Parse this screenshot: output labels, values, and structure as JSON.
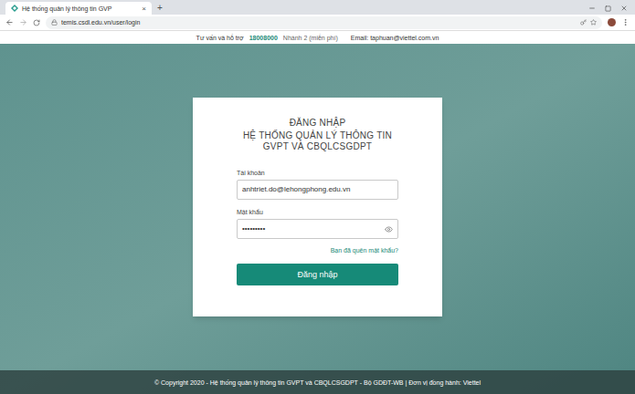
{
  "browser": {
    "tab": {
      "title": "Hệ thống quản lý thông tin GVP",
      "close": "×"
    },
    "new_tab": "+",
    "url": "temis.csdl.edu.vn/user/login"
  },
  "support_bar": {
    "label": "Tư vấn và hỗ trợ",
    "phone": "18008000",
    "branch": "Nhánh 2 (miễn phí)",
    "email": "Email: taphuan@viettel.com.vn"
  },
  "login": {
    "heading": "ĐĂNG NHẬP",
    "title_lines": [
      "HỆ THỐNG QUẢN LÝ THÔNG TIN",
      "GVPT VÀ CBQLCSGDPT"
    ],
    "fields": [
      {
        "label": "Tài khoản",
        "value": "anhtriet.do@lehongphong.edu.vn",
        "kind": "text"
      },
      {
        "label": "Mật khẩu",
        "value": "•••••••••",
        "kind": "password"
      }
    ],
    "forgot": "Bạn đã quên mật khẩu?",
    "button": "Đăng nhập"
  },
  "footer": "© Copyright 2020 - Hệ thống quản lý thông tin GVPT và CBQLCSGDPT - Bộ GDĐT-WB | Đơn vị đồng hành: Viettel"
}
